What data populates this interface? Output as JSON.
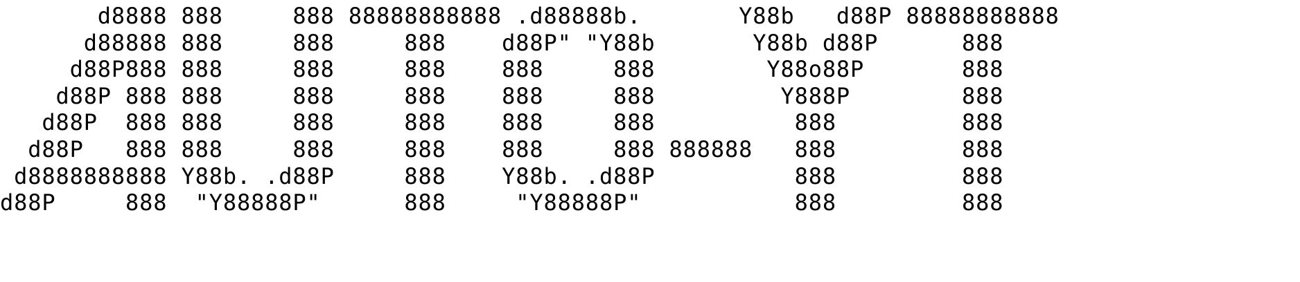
{
  "banner": {
    "lines": [
      "       d8888 888     888 88888888888 .d88888b.       Y88b   d88P 88888888888",
      "      d88888 888     888     888    d88P\" \"Y88b       Y88b d88P      888",
      "     d88P888 888     888     888    888     888        Y88o88P       888",
      "    d88P 888 888     888     888    888     888         Y888P        888",
      "   d88P  888 888     888     888    888     888          888         888",
      "  d88P   888 888     888     888    888     888 888888   888         888",
      " d8888888888 Y88b. .d88P     888    Y88b. .d88P          888         888",
      "d88P     888  \"Y88888P\"      888     \"Y88888P\"           888         888"
    ]
  }
}
